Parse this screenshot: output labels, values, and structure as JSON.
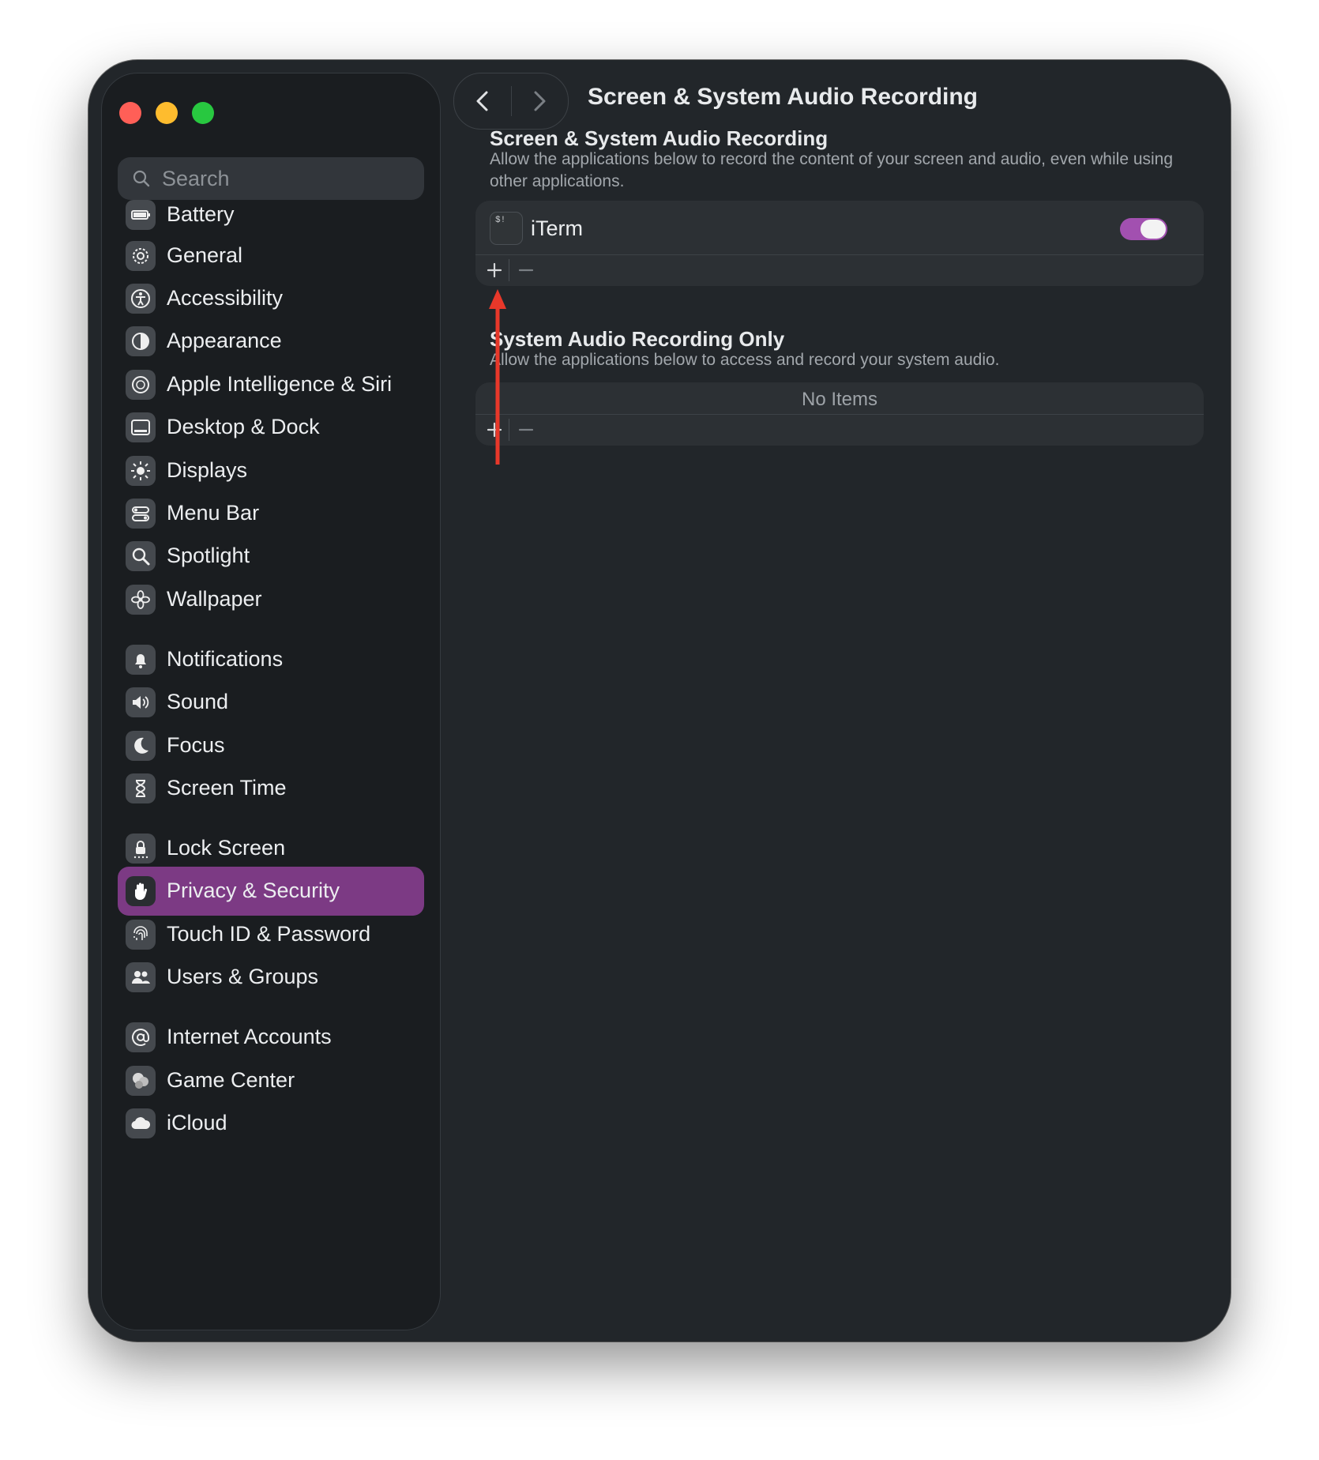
{
  "window": {
    "title": "Screen & System Audio Recording"
  },
  "sidebar": {
    "search_placeholder": "Search",
    "items": [
      {
        "label": "Battery",
        "icon": "battery-icon"
      },
      {
        "label": "General",
        "icon": "gear-icon"
      },
      {
        "label": "Accessibility",
        "icon": "accessibility-icon"
      },
      {
        "label": "Appearance",
        "icon": "appearance-icon"
      },
      {
        "label": "Apple Intelligence & Siri",
        "icon": "siri-icon"
      },
      {
        "label": "Desktop & Dock",
        "icon": "dock-icon"
      },
      {
        "label": "Displays",
        "icon": "sun-icon"
      },
      {
        "label": "Menu Bar",
        "icon": "menu-bar-icon"
      },
      {
        "label": "Spotlight",
        "icon": "magnifier-icon"
      },
      {
        "label": "Wallpaper",
        "icon": "flower-icon"
      },
      {
        "label": "Notifications",
        "icon": "bell-icon"
      },
      {
        "label": "Sound",
        "icon": "speaker-icon"
      },
      {
        "label": "Focus",
        "icon": "moon-icon"
      },
      {
        "label": "Screen Time",
        "icon": "hourglass-icon"
      },
      {
        "label": "Lock Screen",
        "icon": "lock-icon"
      },
      {
        "label": "Privacy & Security",
        "icon": "hand-icon",
        "selected": true
      },
      {
        "label": "Touch ID & Password",
        "icon": "fingerprint-icon"
      },
      {
        "label": "Users & Groups",
        "icon": "users-icon"
      },
      {
        "label": "Internet Accounts",
        "icon": "at-icon"
      },
      {
        "label": "Game Center",
        "icon": "game-center-icon"
      },
      {
        "label": "iCloud",
        "icon": "cloud-icon"
      }
    ]
  },
  "main": {
    "section1": {
      "title": "Screen & System Audio Recording",
      "description": "Allow the applications below to record the content of your screen and audio, even while using other applications.",
      "apps": [
        {
          "name": "iTerm",
          "icon_text": "$!",
          "enabled": true
        }
      ],
      "add_label": "+",
      "remove_label": "–"
    },
    "section2": {
      "title": "System Audio Recording Only",
      "description": "Allow the applications below to access and record your system audio.",
      "empty_text": "No Items",
      "add_label": "+",
      "remove_label": "–"
    }
  },
  "colors": {
    "accent": "#7c3a84",
    "toggle_on": "#a250b0",
    "annotation_arrow": "#e8382a"
  }
}
